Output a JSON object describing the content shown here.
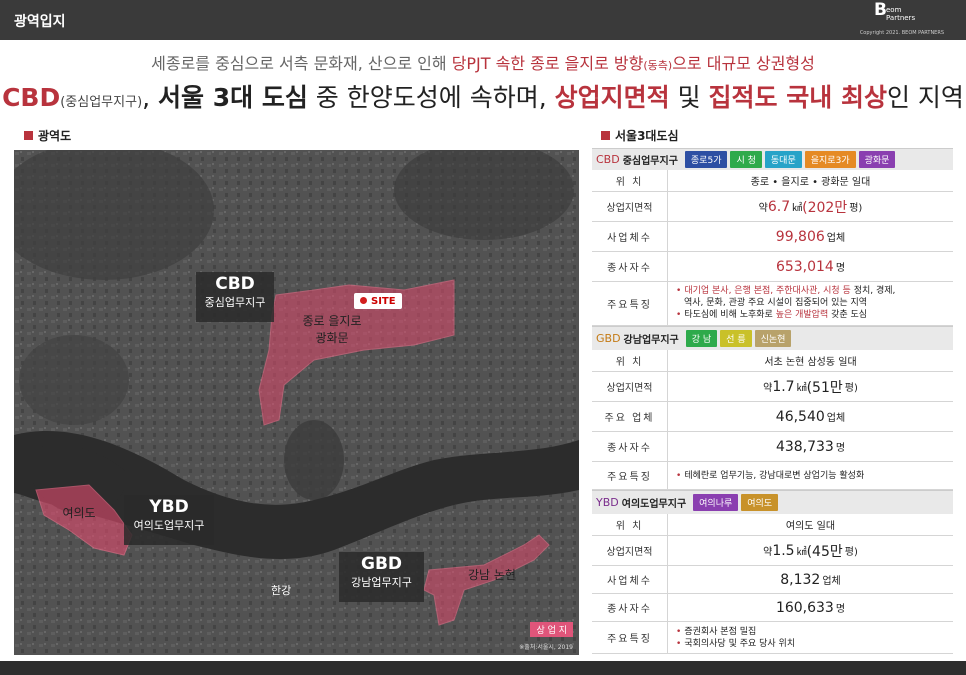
{
  "header": {
    "title": "광역입지",
    "logo_b": "B",
    "logo_text": "eom Partners",
    "copyright": "Copyright 2021. BEOM PARTNERS"
  },
  "subtitle": {
    "part1": "세종로를 중심으로 서측 문화재, 산으로 인해 ",
    "highlight": "당PJT 속한 종로 을지로 방향",
    "small": "(동측)",
    "part2": "으로 대규모 상권형성"
  },
  "headline": {
    "cbd": "CBD",
    "cbd_small": "(중심업무지구)",
    "p1": ", ",
    "b1": "서울 3대 도심",
    "p2": " 중 한양도성에 속하며, ",
    "r1": "상업지면적",
    "p3": " 및 ",
    "r2": "집적도 국내 최상",
    "p4": "인 지역"
  },
  "map_section": {
    "label": "광역도"
  },
  "table_section": {
    "label": "서울3대도심"
  },
  "map": {
    "cbd_big": "CBD",
    "cbd_small": "중심업무지구",
    "ybd_big": "YBD",
    "ybd_small": "여의도업무지구",
    "gbd_big": "GBD",
    "gbd_small": "강남업무지구",
    "area_cbd_1": "종로 을지로",
    "area_cbd_2": "광화문",
    "area_ybd": "여의도",
    "area_gbd": "강남 논현",
    "site": "SITE",
    "river": "한강",
    "legend": "상 업 지",
    "source": "※출처:서울시, 2019"
  },
  "cbd": {
    "code": "CBD",
    "name": "중심업무지구",
    "tags": [
      {
        "label": "종로5가",
        "color": "#2d4fa3"
      },
      {
        "label": "시 청",
        "color": "#2eaa4b"
      },
      {
        "label": "동대문",
        "color": "#27a3c8"
      },
      {
        "label": "을지로3가",
        "color": "#e58a24"
      },
      {
        "label": "광화문",
        "color": "#8a3fb0"
      }
    ],
    "loc_k": "위 치",
    "loc_v": "종로 • 을지로 • 광화문 일대",
    "area_k": "상업지면적",
    "area_pre": "약 ",
    "area_num": "6.7",
    "area_unit": "㎢ ",
    "area_paren": "(202만",
    "area_end": "평)",
    "biz_k": "사업체수",
    "biz_num": "99,806",
    "biz_unit": " 업체",
    "emp_k": "종사자수",
    "emp_num": "653,014",
    "emp_unit": " 명",
    "feat_k": "주요특징",
    "feat_1a": "대기업 본사, 은행 본점, 주한대사관, 시청 등",
    "feat_1b": " 정치, 경제,",
    "feat_2": "역사, 문화, 관광 주요 시설이 집중되어 있는 지역",
    "feat_3a": "타도심에 비해 노후화로 ",
    "feat_3b": "높은 개발압력",
    "feat_3c": " 갖춘 도심"
  },
  "gbd": {
    "code": "GBD",
    "name": "강남업무지구",
    "tags": [
      {
        "label": "강 남",
        "color": "#2eaa4b"
      },
      {
        "label": "선 릉",
        "color": "#c9c129"
      },
      {
        "label": "신논현",
        "color": "#b8a26a"
      }
    ],
    "loc_k": "위 치",
    "loc_v": "서초 논현 삼성동 일대",
    "area_k": "상업지면적",
    "area_pre": "약 ",
    "area_num": "1.7",
    "area_unit": "㎢ ",
    "area_paren": "(51만",
    "area_end": "평)",
    "biz_k": "주요 업체",
    "biz_num": "46,540",
    "biz_unit": " 업체",
    "emp_k": "종사자수",
    "emp_num": "438,733",
    "emp_unit": " 명",
    "feat_k": "주요특징",
    "feat_1": "테헤란로 업무기능, 강남대로변 상업기능 활성화"
  },
  "ybd": {
    "code": "YBD",
    "name": "여의도업무지구",
    "tags": [
      {
        "label": "여의나루",
        "color": "#8a3fb0"
      },
      {
        "label": "여의도",
        "color": "#c8922a"
      }
    ],
    "loc_k": "위 치",
    "loc_v": "여의도 일대",
    "area_k": "상업지면적",
    "area_pre": "약 ",
    "area_num": "1.5",
    "area_unit": "㎢ ",
    "area_paren": "(45만",
    "area_end": "평)",
    "biz_k": "사업체수",
    "biz_num": "8,132",
    "biz_unit": " 업체",
    "emp_k": "종사자수",
    "emp_num": "160,633",
    "emp_unit": " 명",
    "feat_k": "주요특징",
    "feat_1": "증권회사 본점 밀집",
    "feat_2": "국회의사당 및 주요 당사 위치"
  }
}
